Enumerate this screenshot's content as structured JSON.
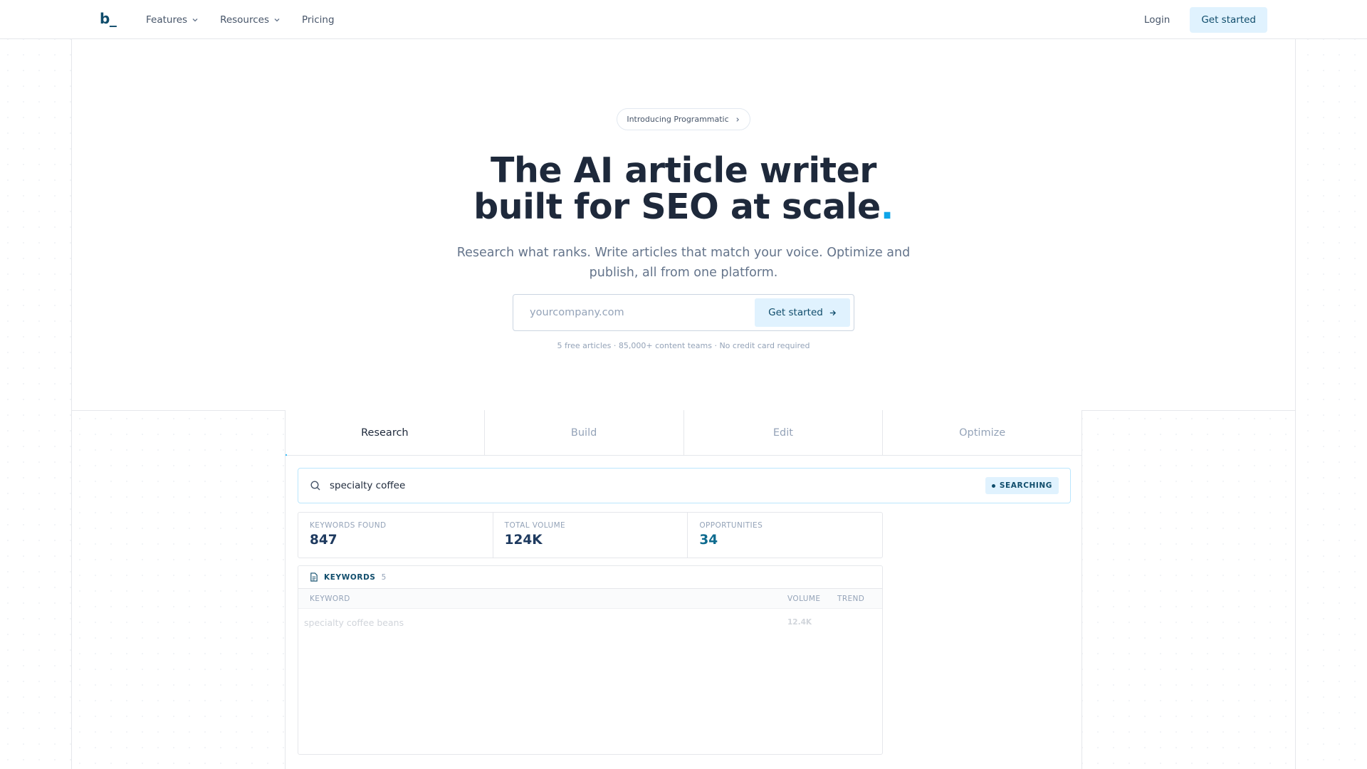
{
  "nav": {
    "logo": "b_",
    "links": [
      {
        "label": "Features"
      },
      {
        "label": "Resources"
      },
      {
        "label": "Pricing"
      }
    ],
    "login": "Login",
    "cta": "Get started"
  },
  "hero": {
    "pill": "Introducing Programmatic",
    "headline_line1": "The AI article writer",
    "headline_line2": "built for SEO at scale",
    "headline_dot": ".",
    "subtitle": "Research what ranks. Write articles that match your voice. Optimize and publish, all from one platform.",
    "input_placeholder": "yourcompany.com",
    "button": "Get started",
    "fine_print": "5 free articles · 85,000+ content teams · No credit card required"
  },
  "demo": {
    "tabs": [
      {
        "label": "Research",
        "active": true
      },
      {
        "label": "Build",
        "active": false
      },
      {
        "label": "Edit",
        "active": false
      },
      {
        "label": "Optimize",
        "active": false
      }
    ],
    "search_query": "specialty coffee",
    "status_badge": "SEARCHING",
    "stats": [
      {
        "label": "KEYWORDS FOUND",
        "value": "847"
      },
      {
        "label": "TOTAL VOLUME",
        "value": "124K"
      },
      {
        "label": "OPPORTUNITIES",
        "value": "34"
      }
    ],
    "keywords": {
      "title": "KEYWORDS",
      "count": "5",
      "columns": [
        "KEYWORD",
        "VOLUME",
        "TREND"
      ],
      "rows": [
        {
          "keyword": "specialty coffee beans",
          "volume": "12.4K",
          "trend": ""
        }
      ]
    }
  },
  "colors": {
    "accent": "#0ea5e9",
    "brand": "#0f4c6b",
    "button_bg": "#e0f2fe"
  }
}
